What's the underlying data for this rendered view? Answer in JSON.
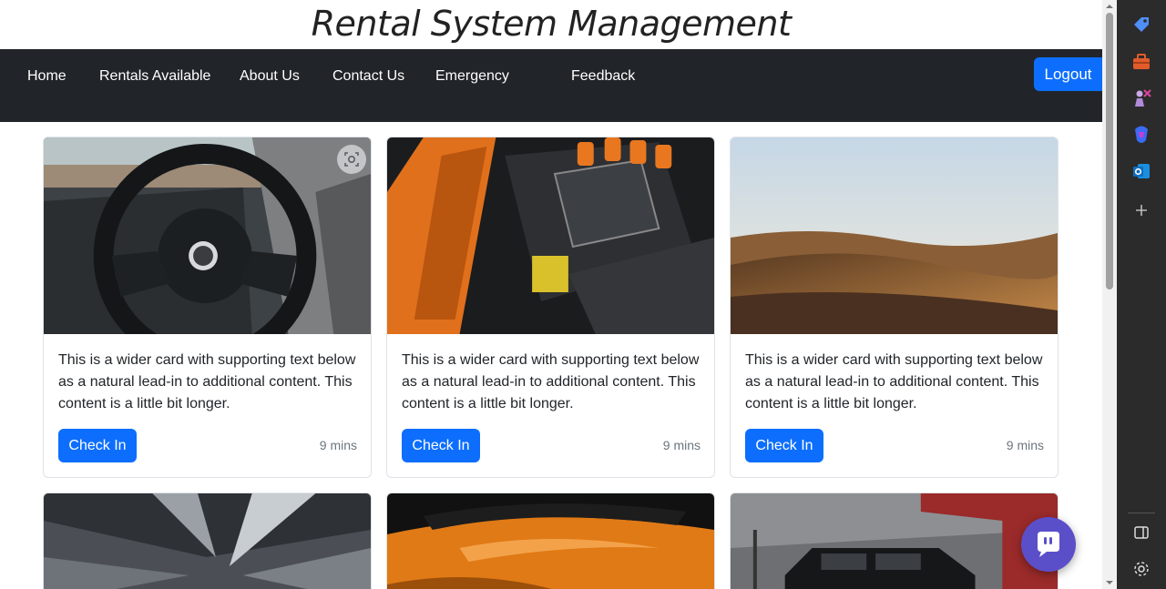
{
  "header": {
    "title": "Rental System Management"
  },
  "nav": {
    "links": [
      "Home",
      "Rentals Available",
      "About Us",
      "Contact Us",
      "Emergency",
      "Feedback"
    ],
    "logout_label": "Logout"
  },
  "cards": [
    {
      "image": "car steering wheel interior",
      "text": "This is a wider card with supporting text below as a natural lead-in to additional content. This content is a little bit longer.",
      "button": "Check In",
      "meta": "9 mins"
    },
    {
      "image": "engine bay orange car",
      "text": "This is a wider card with supporting text below as a natural lead-in to additional content. This content is a little bit longer.",
      "button": "Check In",
      "meta": "9 mins"
    },
    {
      "image": "desert dunes sunset",
      "text": "This is a wider card with supporting text below as a natural lead-in to additional content. This content is a little bit longer.",
      "button": "Check In",
      "meta": "9 mins"
    },
    {
      "image": "tunnel lights"
    },
    {
      "image": "orange sports car hood"
    },
    {
      "image": "black suv under stormy sky"
    }
  ],
  "colors": {
    "accent": "#0d6efd",
    "navbar": "#212529",
    "chat": "#5b4fc9"
  },
  "sidebar_icons": [
    "tag-icon",
    "toolbox-icon",
    "chess-icon",
    "copilot-icon",
    "outlook-icon",
    "plus-icon",
    "panel-icon",
    "settings-icon"
  ]
}
